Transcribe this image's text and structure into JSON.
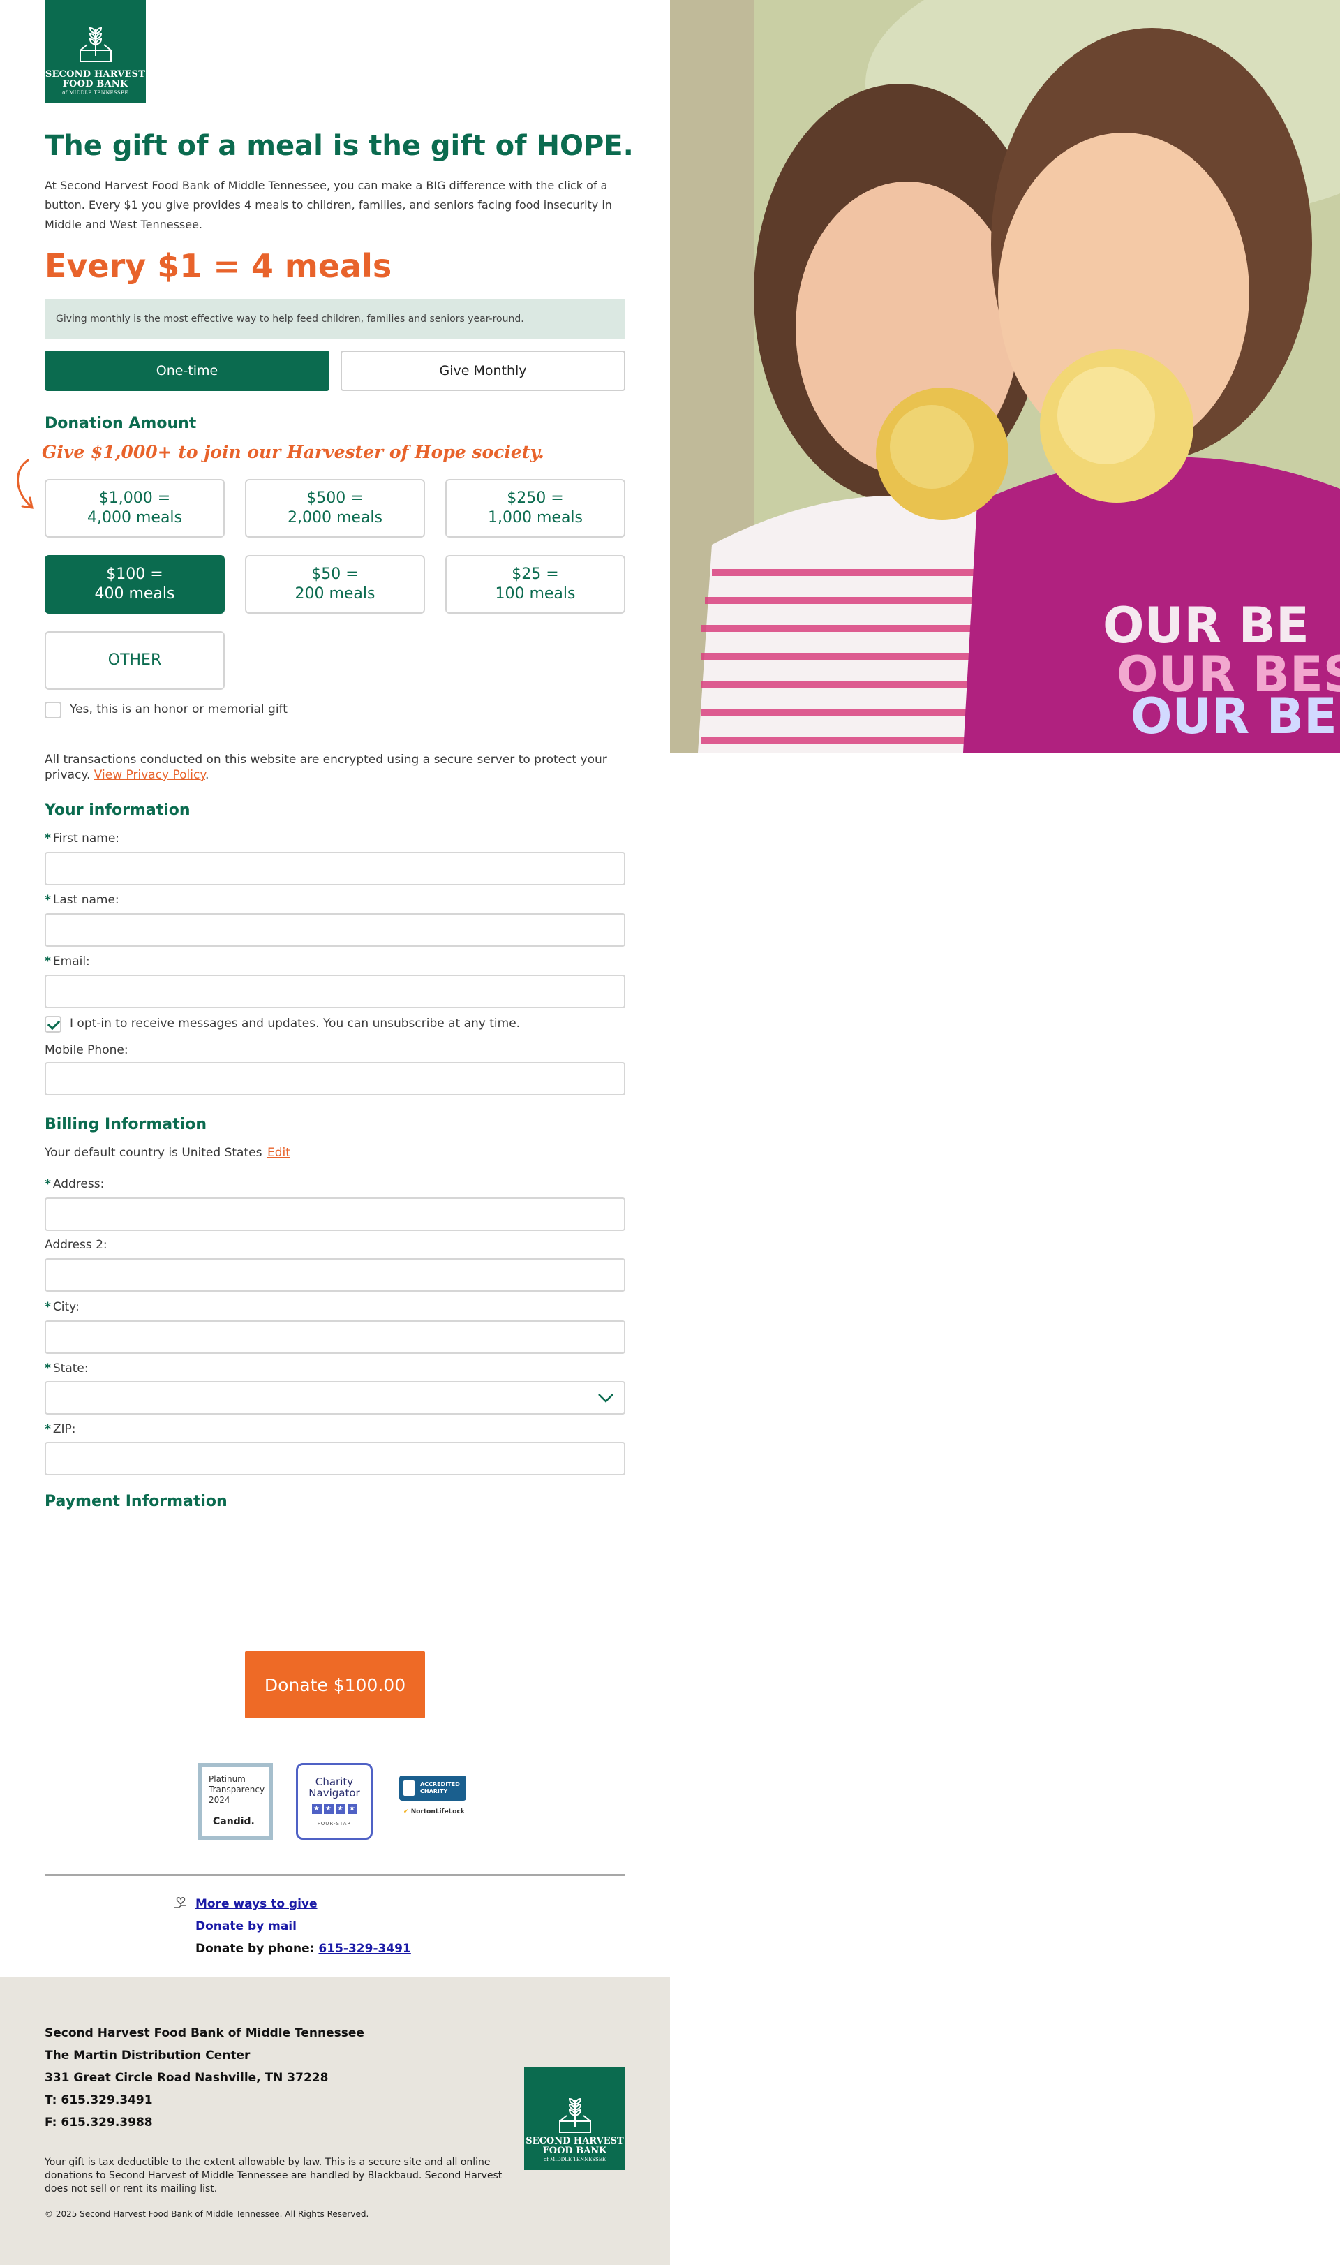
{
  "brand": {
    "logo_line1": "SECOND HARVEST",
    "logo_line2": "FOOD BANK",
    "logo_line3": "of MIDDLE TENNESSEE"
  },
  "hero": {
    "headline": "The gift of a meal is the gift of HOPE.",
    "intro": "At Second Harvest Food Bank of Middle Tennessee, you can make a BIG difference with the click of a button. Every $1 you give provides 4 meals to children, families, and seniors facing food insecurity in Middle and West Tennessee.",
    "equation": "Every $1 = 4 meals",
    "notice": "Giving monthly is the most effective way to help feed children, families and seniors year-round."
  },
  "frequency": {
    "one_time": "One-time",
    "monthly": "Give Monthly",
    "selected": "One-time"
  },
  "donation": {
    "title": "Donation Amount",
    "promo": "Give $1,000+ to join our Harvester of Hope society.",
    "amounts": [
      {
        "line1": "$1,000 =",
        "line2": "4,000 meals"
      },
      {
        "line1": "$500 =",
        "line2": "2,000 meals"
      },
      {
        "line1": "$250 =",
        "line2": "1,000 meals"
      },
      {
        "line1": "$100 =",
        "line2": "400 meals"
      },
      {
        "line1": "$50 =",
        "line2": "200 meals"
      },
      {
        "line1": "$25 =",
        "line2": "100 meals"
      }
    ],
    "selected_amount": "$100",
    "other": "OTHER",
    "honor_label": "Yes, this is an honor or memorial gift"
  },
  "security": {
    "text": "All transactions conducted on this website are encrypted using a secure server to protect your privacy.",
    "link": "View Privacy Policy",
    "period": "."
  },
  "your_info": {
    "title": "Your information",
    "first_name": "First name:",
    "last_name": "Last name:",
    "email": "Email:",
    "optin": "I opt-in to receive messages and updates. You can unsubscribe at any time.",
    "optin_checked": true,
    "mobile": "Mobile Phone:"
  },
  "billing": {
    "title": "Billing Information",
    "country_text": "Your default country is United States",
    "edit": "Edit",
    "address": "Address:",
    "address2": "Address 2:",
    "city": "City:",
    "state": "State:",
    "zip": "ZIP:"
  },
  "payment": {
    "title": "Payment Information",
    "donate_button": "Donate $100.00"
  },
  "badges": {
    "candid_line1": "Platinum",
    "candid_line2": "Transparency",
    "candid_line3": "2024",
    "candid_brand": "Candid.",
    "cn_line1": "Charity",
    "cn_line2": "Navigator",
    "cn_rating": "FOUR-STAR",
    "bbb_line1": "ACCREDITED",
    "bbb_line2": "CHARITY",
    "norton": "NortonLifeLock"
  },
  "more_links": {
    "more_ways": "More ways to give",
    "by_mail": "Donate by mail",
    "phone_label": "Donate by phone:",
    "phone": "615-329-3491"
  },
  "footer": {
    "org": "Second Harvest Food Bank of Middle Tennessee",
    "center": "The Martin Distribution Center",
    "street": "331 Great Circle Road Nashville, TN 37228",
    "tel": "T: 615.329.3491",
    "fax": "F: 615.329.3988",
    "fine": "Your gift is tax deductible to the extent allowable by law. This is a secure site and all online donations to Second Harvest of Middle Tennessee are handled by Blackbaud. Second Harvest does not sell or rent its mailing list.",
    "copyright": "© 2025 Second Harvest Food Bank of Middle Tennessee. All Rights Reserved."
  },
  "colors": {
    "brand_green": "#0b6b4f",
    "accent_orange": "#e8632b",
    "donate_orange": "#ee6a26",
    "notice_bg": "#dbe8e2",
    "footer_bg": "#e8e5de"
  }
}
